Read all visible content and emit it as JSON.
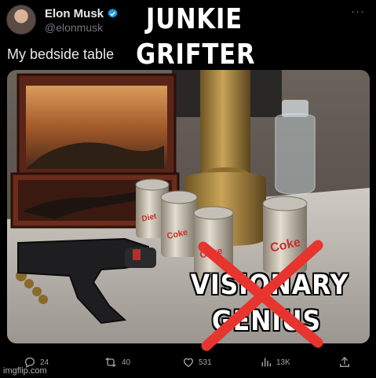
{
  "author": {
    "name": "Elon Musk",
    "handle": "@elonmusk",
    "verified": true
  },
  "menu": {
    "more_label": "···"
  },
  "tweet": {
    "caption": "My bedside table"
  },
  "meme": {
    "top_text": [
      "JUNKIE",
      "GRIFTER"
    ],
    "bottom_text": [
      "VISIONARY",
      "GENIUS"
    ],
    "cross_color": "#e8342f"
  },
  "photo": {
    "can_labels": [
      "Diet Coke",
      "Diet Coke",
      "Diet Coke",
      "Diet Coke"
    ],
    "objects": [
      "painting-box",
      "flintlock-pistol",
      "revolver",
      "lamp-base",
      "water-bottle",
      "diet-coke-cans",
      "rosary"
    ]
  },
  "actions": {
    "replies": "24",
    "retweets": "40",
    "likes": "531",
    "views": "13K"
  },
  "icons": {
    "reply": "reply-icon",
    "retweet": "retweet-icon",
    "like": "heart-icon",
    "views": "views-icon",
    "share": "share-icon"
  },
  "watermark": "imgflip.com",
  "colors": {
    "background": "#000000",
    "text": "#e7e9ea",
    "muted": "#71767b",
    "verified": "#1d9bf0"
  }
}
